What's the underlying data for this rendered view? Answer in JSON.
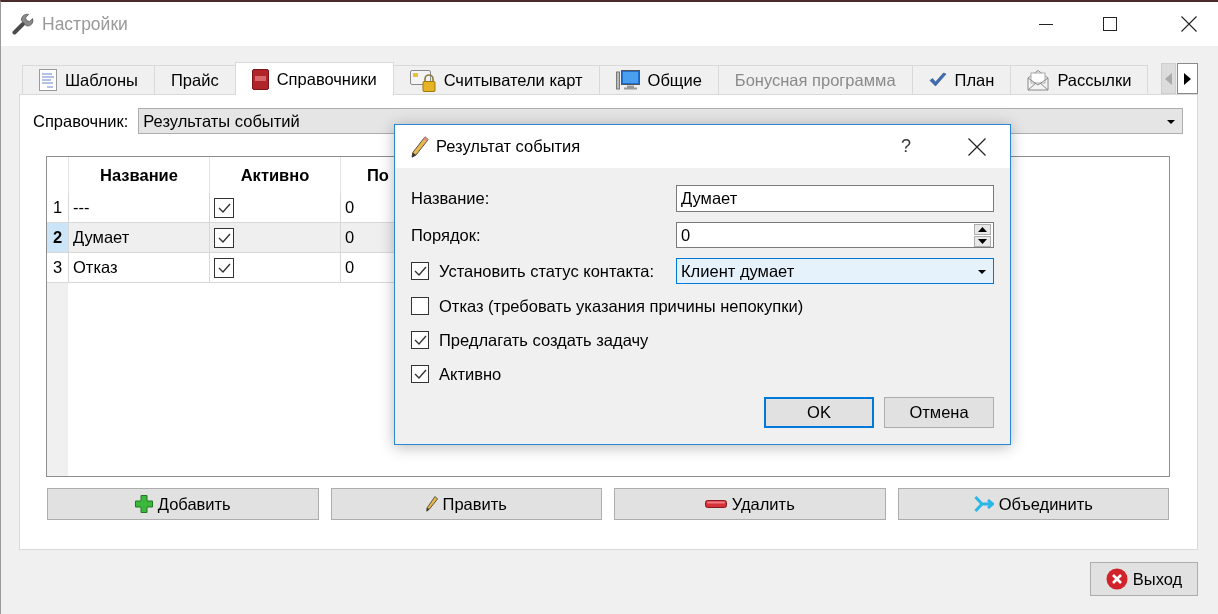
{
  "window": {
    "title": "Настройки",
    "active": false
  },
  "tabs": [
    {
      "label": "Шаблоны",
      "selected": false,
      "disabled": false
    },
    {
      "label": "Прайс",
      "selected": false,
      "disabled": false
    },
    {
      "label": "Справочники",
      "selected": true,
      "disabled": false
    },
    {
      "label": "Считыватели карт",
      "selected": false,
      "disabled": false
    },
    {
      "label": "Общие",
      "selected": false,
      "disabled": false
    },
    {
      "label": "Бонусная программа",
      "selected": false,
      "disabled": true
    },
    {
      "label": "План",
      "selected": false,
      "disabled": false
    },
    {
      "label": "Рассылки",
      "selected": false,
      "disabled": false
    }
  ],
  "tab_scroll_buttons": [
    {
      "kind": "left",
      "disabled": true
    },
    {
      "kind": "right",
      "disabled": false
    }
  ],
  "directory": {
    "label": "Справочник:",
    "value": "Результаты событий"
  },
  "table": {
    "columns": [
      "Название",
      "Активно",
      "По"
    ],
    "rows": [
      {
        "number": "1",
        "name": "---",
        "active": true,
        "column_3": "0",
        "selected": false
      },
      {
        "number": "2",
        "name": "Думает",
        "active": true,
        "column_3": "0",
        "selected": true
      },
      {
        "number": "3",
        "name": "Отказ",
        "active": true,
        "column_3": "0",
        "selected": false
      }
    ]
  },
  "actions": [
    {
      "label": "Добавить"
    },
    {
      "label": "Править"
    },
    {
      "label": "Удалить"
    },
    {
      "label": "Объединить"
    }
  ],
  "exit_button": {
    "label": "Выход"
  },
  "dialog": {
    "title": "Результат события",
    "help": "?",
    "rows": [
      {
        "kind": "text",
        "label": "Название:",
        "value": "Думает"
      },
      {
        "kind": "spin",
        "label": "Порядок:",
        "value": "0"
      },
      {
        "kind": "check-combo",
        "label": "Установить статус контакта:",
        "checked": true,
        "value": "Клиент думает",
        "focused": true
      },
      {
        "kind": "check",
        "label": "Отказ (требовать указания причины непокупки)",
        "checked": false
      },
      {
        "kind": "check",
        "label": "Предлагать создать задачу",
        "checked": true
      },
      {
        "kind": "check",
        "label": "Активно",
        "checked": true
      }
    ],
    "buttons": [
      {
        "label": "OK",
        "default": true
      },
      {
        "label": "Отмена",
        "default": false
      }
    ]
  }
}
